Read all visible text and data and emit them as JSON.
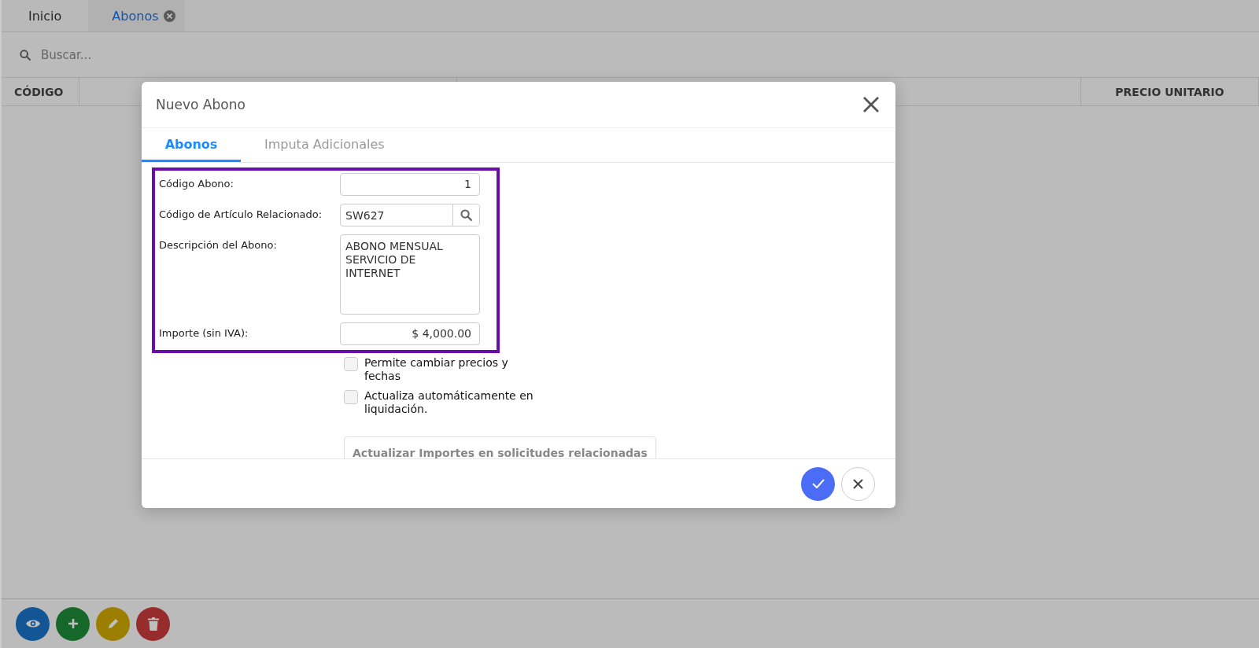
{
  "tabs": [
    {
      "label": "Inicio",
      "selected": false,
      "closable": false
    },
    {
      "label": "Abonos",
      "selected": true,
      "closable": true
    }
  ],
  "search": {
    "placeholder": "Buscar..."
  },
  "table": {
    "columns": [
      "CÓDIGO",
      "PRECIO UNITARIO"
    ]
  },
  "toolbar": [
    {
      "kind": "view"
    },
    {
      "kind": "add"
    },
    {
      "kind": "edit"
    },
    {
      "kind": "delete"
    }
  ],
  "dialog": {
    "title": "Nuevo Abono",
    "tabs": [
      {
        "label": "Abonos",
        "selected": true
      },
      {
        "label": "Imputa Adicionales",
        "selected": false
      }
    ],
    "fields": [
      {
        "kind": "number",
        "label": "Código Abono:",
        "value": "1"
      },
      {
        "kind": "lookup",
        "label": "Código de Artículo Relacionado:",
        "value": "SW627"
      },
      {
        "kind": "textarea",
        "label": "Descripción del Abono:",
        "value": "ABONO MENSUAL SERVICIO DE INTERNET"
      },
      {
        "kind": "number",
        "label": "Importe (sin IVA):",
        "value": "$ 4,000.00"
      }
    ],
    "checkboxes": [
      {
        "label": "Permite cambiar precios y fechas",
        "checked": false
      },
      {
        "label": "Actualiza automáticamente en liquidación.",
        "checked": false
      }
    ],
    "action_button": "Actualizar Importes en solicitudes relacionadas"
  }
}
